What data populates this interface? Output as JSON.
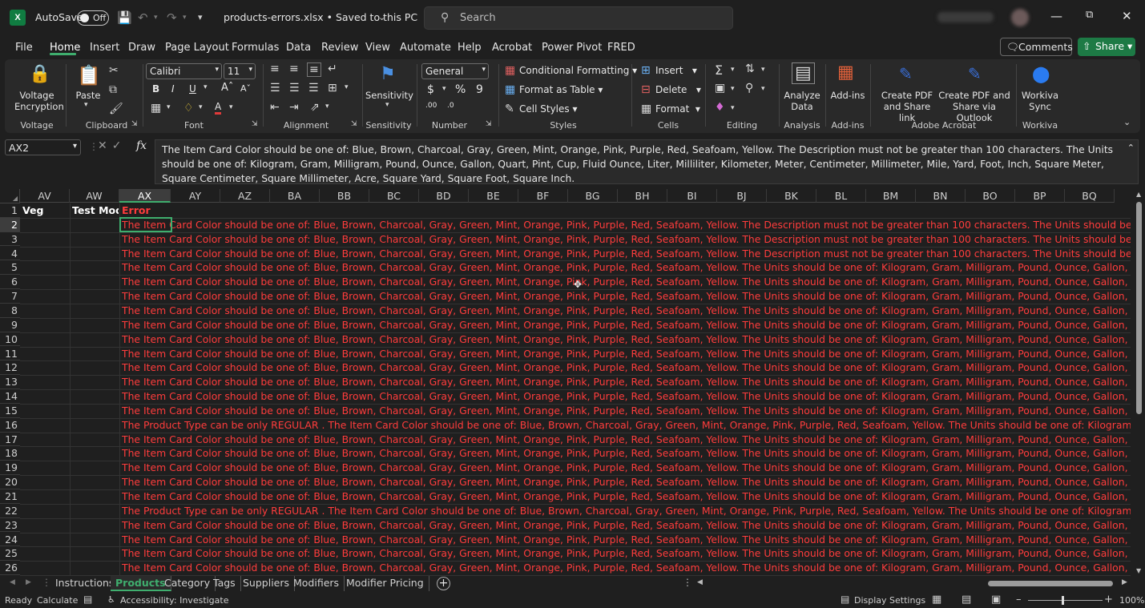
{
  "titlebar": {
    "app_icon": "X",
    "autosave_label": "AutoSave",
    "autosave_state": "Off",
    "filename": "products-errors.xlsx • Saved to this PC",
    "search_placeholder": "Search"
  },
  "menu": {
    "items": [
      "File",
      "Home",
      "Insert",
      "Draw",
      "Page Layout",
      "Formulas",
      "Data",
      "Review",
      "View",
      "Automate",
      "Help",
      "Acrobat",
      "Power Pivot",
      "FRED"
    ],
    "active": "Home",
    "comments_label": "Comments",
    "share_label": "Share"
  },
  "ribbon": {
    "voltage": {
      "button": "Voltage\nEncryption",
      "group": "Voltage"
    },
    "clipboard": {
      "paste": "Paste",
      "group": "Clipboard"
    },
    "font": {
      "name": "Calibri",
      "size": "11",
      "group": "Font"
    },
    "alignment": {
      "group": "Alignment"
    },
    "sensitivity": {
      "button": "Sensitivity",
      "group": "Sensitivity"
    },
    "number": {
      "format": "General",
      "group": "Number"
    },
    "styles": {
      "conditional": "Conditional Formatting",
      "table": "Format as Table",
      "cell_styles": "Cell Styles",
      "group": "Styles"
    },
    "cells": {
      "insert": "Insert",
      "delete": "Delete",
      "format": "Format",
      "group": "Cells"
    },
    "editing": {
      "group": "Editing"
    },
    "analysis": {
      "button": "Analyze\nData",
      "group": "Analysis"
    },
    "addins": {
      "button": "Add-ins",
      "group": "Add-ins"
    },
    "acrobat": {
      "pdf_link": "Create PDF\nand Share link",
      "pdf_outlook": "Create PDF and\nShare via Outlook",
      "group": "Adobe Acrobat"
    },
    "workiva": {
      "button": "Workiva\nSync",
      "group": "Workiva"
    }
  },
  "formula_bar": {
    "name_box": "AX2",
    "fx": "fx",
    "content": "The Item Card Color should be one of: Blue, Brown, Charcoal, Gray, Green, Mint, Orange, Pink, Purple, Red, Seafoam, Yellow. The Description must not be greater than 100 characters. The Units should be one of: Kilogram, Gram, Milligram, Pound, Ounce, Gallon, Quart, Pint, Cup, Fluid Ounce, Liter, Milliliter, Kilometer, Meter, Centimeter, Millimeter, Mile, Yard, Foot, Inch, Square Meter, Square Centimeter, Square Millimeter, Acre, Square Yard, Square Foot, Square Inch."
  },
  "grid": {
    "columns": [
      "AV",
      "AW",
      "AX",
      "AY",
      "AZ",
      "BA",
      "BB",
      "BC",
      "BD",
      "BE",
      "BF",
      "BG",
      "BH",
      "BI",
      "BJ",
      "BK",
      "BL",
      "BM",
      "BN",
      "BO",
      "BP",
      "BQ"
    ],
    "selected_column": "AX",
    "headers": {
      "AV": "Veg",
      "AW": "Test Modif",
      "AX": "Error"
    },
    "rows": [
      {
        "n": "1"
      },
      {
        "n": "2",
        "error": "The Item Card Color should be one of: Blue, Brown, Charcoal, Gray, Green, Mint, Orange, Pink, Purple, Red, Seafoam, Yellow. The Description must not be greater than 100 characters. The Units should be one of: Kilogram, Gram,"
      },
      {
        "n": "3",
        "error": "The Item Card Color should be one of: Blue, Brown, Charcoal, Gray, Green, Mint, Orange, Pink, Purple, Red, Seafoam, Yellow. The Description must not be greater than 100 characters. The Units should be one of: Kilogram, Gram,"
      },
      {
        "n": "4",
        "error": "The Item Card Color should be one of: Blue, Brown, Charcoal, Gray, Green, Mint, Orange, Pink, Purple, Red, Seafoam, Yellow. The Description must not be greater than 100 characters. The Units should be one of: Kilogram, Gram,"
      },
      {
        "n": "5",
        "error": "The Item Card Color should be one of: Blue, Brown, Charcoal, Gray, Green, Mint, Orange, Pink, Purple, Red, Seafoam, Yellow. The Units should be one of: Kilogram, Gram, Milligram, Pound, Ounce, Gallon, Quart, Pint, Cup, Fluid O"
      },
      {
        "n": "6",
        "error": "The Item Card Color should be one of: Blue, Brown, Charcoal, Gray, Green, Mint, Orange, Pink, Purple, Red, Seafoam, Yellow. The Units should be one of: Kilogram, Gram, Milligram, Pound, Ounce, Gallon, Quart, Pint, Cup, Fluid O"
      },
      {
        "n": "7",
        "error": "The Item Card Color should be one of: Blue, Brown, Charcoal, Gray, Green, Mint, Orange, Pink, Purple, Red, Seafoam, Yellow. The Units should be one of: Kilogram, Gram, Milligram, Pound, Ounce, Gallon, Quart, Pint, Cup, Fluid O"
      },
      {
        "n": "8",
        "error": "The Item Card Color should be one of: Blue, Brown, Charcoal, Gray, Green, Mint, Orange, Pink, Purple, Red, Seafoam, Yellow. The Units should be one of: Kilogram, Gram, Milligram, Pound, Ounce, Gallon, Quart, Pint, Cup, Fluid O"
      },
      {
        "n": "9",
        "error": "The Item Card Color should be one of: Blue, Brown, Charcoal, Gray, Green, Mint, Orange, Pink, Purple, Red, Seafoam, Yellow. The Units should be one of: Kilogram, Gram, Milligram, Pound, Ounce, Gallon, Quart, Pint, Cup, Fluid O"
      },
      {
        "n": "10",
        "error": "The Item Card Color should be one of: Blue, Brown, Charcoal, Gray, Green, Mint, Orange, Pink, Purple, Red, Seafoam, Yellow. The Units should be one of: Kilogram, Gram, Milligram, Pound, Ounce, Gallon, Quart, Pint, Cup, Fluid O"
      },
      {
        "n": "11",
        "error": "The Item Card Color should be one of: Blue, Brown, Charcoal, Gray, Green, Mint, Orange, Pink, Purple, Red, Seafoam, Yellow. The Units should be one of: Kilogram, Gram, Milligram, Pound, Ounce, Gallon, Quart, Pint, Cup, Fluid O"
      },
      {
        "n": "12",
        "error": "The Item Card Color should be one of: Blue, Brown, Charcoal, Gray, Green, Mint, Orange, Pink, Purple, Red, Seafoam, Yellow. The Units should be one of: Kilogram, Gram, Milligram, Pound, Ounce, Gallon, Quart, Pint, Cup, Fluid O"
      },
      {
        "n": "13",
        "error": "The Item Card Color should be one of: Blue, Brown, Charcoal, Gray, Green, Mint, Orange, Pink, Purple, Red, Seafoam, Yellow. The Units should be one of: Kilogram, Gram, Milligram, Pound, Ounce, Gallon, Quart, Pint, Cup, Fluid O"
      },
      {
        "n": "14",
        "error": "The Item Card Color should be one of: Blue, Brown, Charcoal, Gray, Green, Mint, Orange, Pink, Purple, Red, Seafoam, Yellow. The Units should be one of: Kilogram, Gram, Milligram, Pound, Ounce, Gallon, Quart, Pint, Cup, Fluid O"
      },
      {
        "n": "15",
        "error": "The Item Card Color should be one of: Blue, Brown, Charcoal, Gray, Green, Mint, Orange, Pink, Purple, Red, Seafoam, Yellow. The Units should be one of: Kilogram, Gram, Milligram, Pound, Ounce, Gallon, Quart, Pint, Cup, Fluid O"
      },
      {
        "n": "16",
        "error": "The Product Type can be only REGULAR . The Item Card Color should be one of: Blue, Brown, Charcoal, Gray, Green, Mint, Orange, Pink, Purple, Red, Seafoam, Yellow. The Units should be one of: Kilogram, Gram, Milligram, Pound"
      },
      {
        "n": "17",
        "error": "The Item Card Color should be one of: Blue, Brown, Charcoal, Gray, Green, Mint, Orange, Pink, Purple, Red, Seafoam, Yellow. The Units should be one of: Kilogram, Gram, Milligram, Pound, Ounce, Gallon, Quart, Pint, Cup, Fluid O"
      },
      {
        "n": "18",
        "error": "The Item Card Color should be one of: Blue, Brown, Charcoal, Gray, Green, Mint, Orange, Pink, Purple, Red, Seafoam, Yellow. The Units should be one of: Kilogram, Gram, Milligram, Pound, Ounce, Gallon, Quart, Pint, Cup, Fluid O"
      },
      {
        "n": "19",
        "error": "The Item Card Color should be one of: Blue, Brown, Charcoal, Gray, Green, Mint, Orange, Pink, Purple, Red, Seafoam, Yellow. The Units should be one of: Kilogram, Gram, Milligram, Pound, Ounce, Gallon, Quart, Pint, Cup, Fluid O"
      },
      {
        "n": "20",
        "error": "The Item Card Color should be one of: Blue, Brown, Charcoal, Gray, Green, Mint, Orange, Pink, Purple, Red, Seafoam, Yellow. The Units should be one of: Kilogram, Gram, Milligram, Pound, Ounce, Gallon, Quart, Pint, Cup, Fluid O"
      },
      {
        "n": "21",
        "error": "The Item Card Color should be one of: Blue, Brown, Charcoal, Gray, Green, Mint, Orange, Pink, Purple, Red, Seafoam, Yellow. The Units should be one of: Kilogram, Gram, Milligram, Pound, Ounce, Gallon, Quart, Pint, Cup, Fluid O"
      },
      {
        "n": "22",
        "error": "The Product Type can be only REGULAR . The Item Card Color should be one of: Blue, Brown, Charcoal, Gray, Green, Mint, Orange, Pink, Purple, Red, Seafoam, Yellow. The Units should be one of: Kilogram, Gram, Milligram, Pound"
      },
      {
        "n": "23",
        "error": "The Item Card Color should be one of: Blue, Brown, Charcoal, Gray, Green, Mint, Orange, Pink, Purple, Red, Seafoam, Yellow. The Units should be one of: Kilogram, Gram, Milligram, Pound, Ounce, Gallon, Quart, Pint, Cup, Fluid O"
      },
      {
        "n": "24",
        "error": "The Item Card Color should be one of: Blue, Brown, Charcoal, Gray, Green, Mint, Orange, Pink, Purple, Red, Seafoam, Yellow. The Units should be one of: Kilogram, Gram, Milligram, Pound, Ounce, Gallon, Quart, Pint, Cup, Fluid O"
      },
      {
        "n": "25",
        "error": "The Item Card Color should be one of: Blue, Brown, Charcoal, Gray, Green, Mint, Orange, Pink, Purple, Red, Seafoam, Yellow. The Units should be one of: Kilogram, Gram, Milligram, Pound, Ounce, Gallon, Quart, Pint, Cup, Fluid O"
      },
      {
        "n": "26",
        "error": "The Item Card Color should be one of: Blue, Brown, Charcoal, Gray, Green, Mint, Orange, Pink, Purple, Red, Seafoam, Yellow. The Units should be one of: Kilogram, Gram, Milligram, Pound, Ounce, Gallon, Quart, Pint, Cup, Fluid O"
      }
    ]
  },
  "sheet_tabs": [
    "Instructions",
    "Products",
    "Category",
    "Tags",
    "Suppliers",
    "Modifiers",
    "Modifier Pricing"
  ],
  "active_sheet": "Products",
  "status": {
    "ready": "Ready",
    "calculate": "Calculate",
    "accessibility": "Accessibility: Investigate",
    "display_settings": "Display Settings",
    "zoom": "100%"
  },
  "colors": {
    "accent": "#3fae6e",
    "error_text": "#ff3c3c",
    "share": "#1d7a45"
  }
}
